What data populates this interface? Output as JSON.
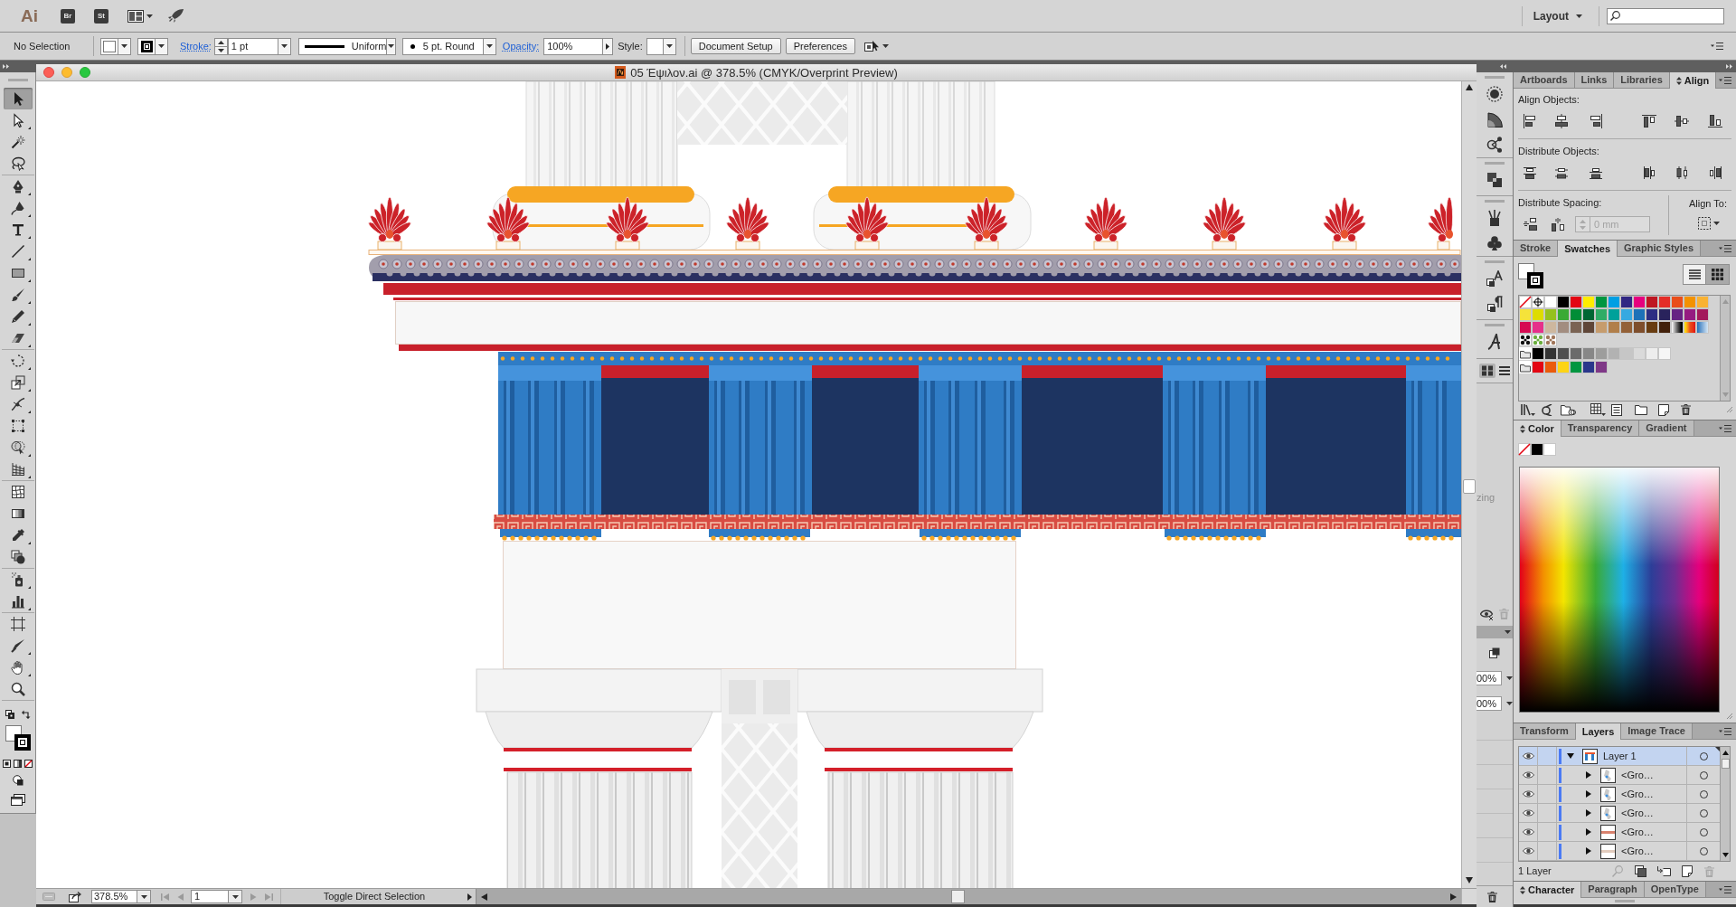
{
  "app_bar": {
    "logo": "Ai",
    "apps": [
      "Br",
      "St"
    ],
    "workspace": "Layout"
  },
  "control_bar": {
    "selection": "No Selection",
    "stroke_label": "Stroke:",
    "stroke_weight": "1 pt",
    "profile": "Uniform",
    "brush": "5 pt. Round",
    "opacity_label": "Opacity:",
    "opacity": "100%",
    "style_label": "Style:",
    "buttons": [
      "Document Setup",
      "Preferences"
    ]
  },
  "document": {
    "title": "05 Έψιλον.ai @ 378.5% (CMYK/Overprint Preview)"
  },
  "tool_groups": [
    [
      {
        "kind": "selection",
        "selected": true,
        "flyout": false
      },
      {
        "kind": "direct-selection",
        "selected": false,
        "flyout": true
      },
      {
        "kind": "magic-wand",
        "selected": false,
        "flyout": false
      },
      {
        "kind": "lasso",
        "selected": false,
        "flyout": false
      }
    ],
    [
      {
        "kind": "pen",
        "selected": false,
        "flyout": true
      },
      {
        "kind": "curvature",
        "selected": false,
        "flyout": true
      },
      {
        "kind": "type",
        "selected": false,
        "flyout": true
      },
      {
        "kind": "line",
        "selected": false,
        "flyout": true
      },
      {
        "kind": "rectangle",
        "selected": false,
        "flyout": true
      },
      {
        "kind": "paintbrush",
        "selected": false,
        "flyout": true
      },
      {
        "kind": "pencil",
        "selected": false,
        "flyout": true
      },
      {
        "kind": "eraser",
        "selected": false,
        "flyout": true
      }
    ],
    [
      {
        "kind": "rotate",
        "selected": false,
        "flyout": true
      },
      {
        "kind": "scale",
        "selected": false,
        "flyout": true
      },
      {
        "kind": "width",
        "selected": false,
        "flyout": true
      },
      {
        "kind": "free-transform",
        "selected": false,
        "flyout": false
      },
      {
        "kind": "shape-builder",
        "selected": false,
        "flyout": true
      },
      {
        "kind": "perspective-grid",
        "selected": false,
        "flyout": true
      }
    ],
    [
      {
        "kind": "mesh",
        "selected": false,
        "flyout": false
      },
      {
        "kind": "gradient",
        "selected": false,
        "flyout": false
      },
      {
        "kind": "eyedropper",
        "selected": false,
        "flyout": true
      },
      {
        "kind": "blend",
        "selected": false,
        "flyout": false
      }
    ],
    [
      {
        "kind": "symbol-sprayer",
        "selected": false,
        "flyout": true
      },
      {
        "kind": "column-graph",
        "selected": false,
        "flyout": true
      }
    ],
    [
      {
        "kind": "artboard",
        "selected": false,
        "flyout": false
      },
      {
        "kind": "slice",
        "selected": false,
        "flyout": true
      },
      {
        "kind": "hand",
        "selected": false,
        "flyout": true
      },
      {
        "kind": "zoom",
        "selected": false,
        "flyout": false
      }
    ]
  ],
  "align_panel": {
    "tabs": [
      {
        "label": "Artboards",
        "selected": false,
        "toggle": false
      },
      {
        "label": "Links",
        "selected": false,
        "toggle": false
      },
      {
        "label": "Libraries",
        "selected": false,
        "toggle": false
      },
      {
        "label": "Align",
        "selected": true,
        "toggle": true
      }
    ],
    "align_objects": "Align Objects:",
    "distribute_objects": "Distribute Objects:",
    "distribute_spacing": "Distribute Spacing:",
    "spacing": {
      "value": "0 mm",
      "disabled": true
    },
    "align_to": "Align To:"
  },
  "swatches_panel": {
    "tabs": [
      {
        "label": "Stroke",
        "selected": false,
        "toggle": false
      },
      {
        "label": "Swatches",
        "selected": true,
        "toggle": false
      },
      {
        "label": "Graphic Styles",
        "selected": false,
        "toggle": false
      }
    ],
    "views": [
      {
        "kind": "list",
        "selected": false
      },
      {
        "kind": "grid",
        "selected": true
      }
    ],
    "rows": [
      {
        "kind": "plain",
        "swatches": [
          {
            "kind": "none"
          },
          {
            "kind": "registration"
          },
          {
            "kind": "solid",
            "color": "#ffffff"
          },
          {
            "kind": "solid",
            "color": "#000000"
          },
          {
            "kind": "solid",
            "color": "#e30613"
          },
          {
            "kind": "solid",
            "color": "#ffed00"
          },
          {
            "kind": "solid",
            "color": "#009640"
          },
          {
            "kind": "solid",
            "color": "#009fe3"
          },
          {
            "kind": "solid",
            "color": "#312783"
          },
          {
            "kind": "solid",
            "color": "#e6007e"
          },
          {
            "kind": "solid",
            "color": "#be1622"
          },
          {
            "kind": "solid",
            "color": "#e42d28"
          },
          {
            "kind": "solid",
            "color": "#e94e1b"
          },
          {
            "kind": "solid",
            "color": "#f39200"
          },
          {
            "kind": "solid",
            "color": "#f9b233"
          }
        ]
      },
      {
        "kind": "plain",
        "swatches": [
          {
            "kind": "solid",
            "color": "#f5e33a"
          },
          {
            "kind": "solid",
            "color": "#dedc00"
          },
          {
            "kind": "solid",
            "color": "#95c11f"
          },
          {
            "kind": "solid",
            "color": "#3aaa35"
          },
          {
            "kind": "solid",
            "color": "#008d36"
          },
          {
            "kind": "solid",
            "color": "#006633"
          },
          {
            "kind": "solid",
            "color": "#2fac66"
          },
          {
            "kind": "solid",
            "color": "#00a19a"
          },
          {
            "kind": "solid",
            "color": "#36a9e1"
          },
          {
            "kind": "solid",
            "color": "#1d71b8"
          },
          {
            "kind": "solid",
            "color": "#2d2e83"
          },
          {
            "kind": "solid",
            "color": "#29235c"
          },
          {
            "kind": "solid",
            "color": "#662483"
          },
          {
            "kind": "solid",
            "color": "#951b81"
          },
          {
            "kind": "solid",
            "color": "#a3195b"
          }
        ]
      },
      {
        "kind": "plain",
        "swatches": [
          {
            "kind": "solid",
            "color": "#d60b52"
          },
          {
            "kind": "solid",
            "color": "#e6308a"
          },
          {
            "kind": "solid",
            "color": "#cdb79e"
          },
          {
            "kind": "solid",
            "color": "#a28d80"
          },
          {
            "kind": "solid",
            "color": "#7a6353"
          },
          {
            "kind": "solid",
            "color": "#5f4638"
          },
          {
            "kind": "solid",
            "color": "#c69c6d"
          },
          {
            "kind": "solid",
            "color": "#b17f4a"
          },
          {
            "kind": "solid",
            "color": "#936037"
          },
          {
            "kind": "solid",
            "color": "#7e4e2c"
          },
          {
            "kind": "solid",
            "color": "#683c11"
          },
          {
            "kind": "solid",
            "color": "#42210b"
          },
          {
            "kind": "grayscale-gradient"
          },
          {
            "kind": "warm-gradient"
          },
          {
            "kind": "blue-gradient"
          }
        ]
      },
      {
        "kind": "plain",
        "swatches": [
          {
            "kind": "pattern",
            "color": "#111111"
          },
          {
            "kind": "pattern",
            "color": "#6aae3e"
          },
          {
            "kind": "pattern",
            "color": "#a0765a"
          }
        ]
      },
      {
        "kind": "group",
        "swatches": [
          {
            "kind": "solid",
            "color": "#000000"
          },
          {
            "kind": "solid",
            "color": "#343434"
          },
          {
            "kind": "solid",
            "color": "#4f4f4f"
          },
          {
            "kind": "solid",
            "color": "#6b6b6b"
          },
          {
            "kind": "solid",
            "color": "#878787"
          },
          {
            "kind": "solid",
            "color": "#9d9d9c"
          },
          {
            "kind": "solid",
            "color": "#b2b2b2"
          },
          {
            "kind": "solid",
            "color": "#c6c6c6"
          },
          {
            "kind": "solid",
            "color": "#dadada"
          },
          {
            "kind": "solid",
            "color": "#ededed"
          },
          {
            "kind": "solid",
            "color": "#f6f6f6"
          }
        ]
      },
      {
        "kind": "group",
        "swatches": [
          {
            "kind": "solid",
            "color": "#e30613"
          },
          {
            "kind": "solid",
            "color": "#ea5b0c"
          },
          {
            "kind": "solid",
            "color": "#fdd416"
          },
          {
            "kind": "solid",
            "color": "#009640"
          },
          {
            "kind": "solid",
            "color": "#2a378b"
          },
          {
            "kind": "solid",
            "color": "#7f3887"
          }
        ]
      }
    ]
  },
  "color_panel": {
    "tabs": [
      {
        "label": "Color",
        "selected": true,
        "toggle": true
      },
      {
        "label": "Transparency",
        "selected": false,
        "toggle": false
      },
      {
        "label": "Gradient",
        "selected": false,
        "toggle": false
      }
    ],
    "swatches": [
      {
        "kind": "none"
      },
      {
        "kind": "solid",
        "color": "#000000"
      },
      {
        "kind": "solid",
        "color": "#ffffff"
      }
    ]
  },
  "layers_panel": {
    "tabs": [
      {
        "label": "Transform",
        "selected": false,
        "toggle": false
      },
      {
        "label": "Layers",
        "selected": true,
        "toggle": false
      },
      {
        "label": "Image Trace",
        "selected": false,
        "toggle": false
      }
    ],
    "layers": [
      {
        "name": "Layer 1",
        "visible": true,
        "expanded": true,
        "selected": true,
        "kind": "page",
        "children": [
          {
            "name": "<Gro…",
            "visible": true,
            "expanded": false,
            "selected": false,
            "kind": "figure"
          },
          {
            "name": "<Gro…",
            "visible": true,
            "expanded": false,
            "selected": false,
            "kind": "figure"
          },
          {
            "name": "<Gro…",
            "visible": true,
            "expanded": false,
            "selected": false,
            "kind": "figure"
          },
          {
            "name": "<Gro…",
            "visible": true,
            "expanded": false,
            "selected": false,
            "kind": "band"
          },
          {
            "name": "<Gro…",
            "visible": true,
            "expanded": false,
            "selected": false,
            "kind": "faint-band"
          }
        ]
      }
    ],
    "count": "1 Layer"
  },
  "character_panel": {
    "tabs": [
      {
        "label": "Character",
        "selected": true,
        "toggle": true
      },
      {
        "label": "Paragraph",
        "selected": false,
        "toggle": false
      },
      {
        "label": "OpenType",
        "selected": false,
        "toggle": false
      }
    ]
  },
  "hidden_panel": {
    "label": "zing",
    "fields": [
      "00%",
      "00%"
    ]
  },
  "status_bar": {
    "zoom": "378.5%",
    "artboard": "1",
    "status": "Toggle Direct Selection"
  }
}
